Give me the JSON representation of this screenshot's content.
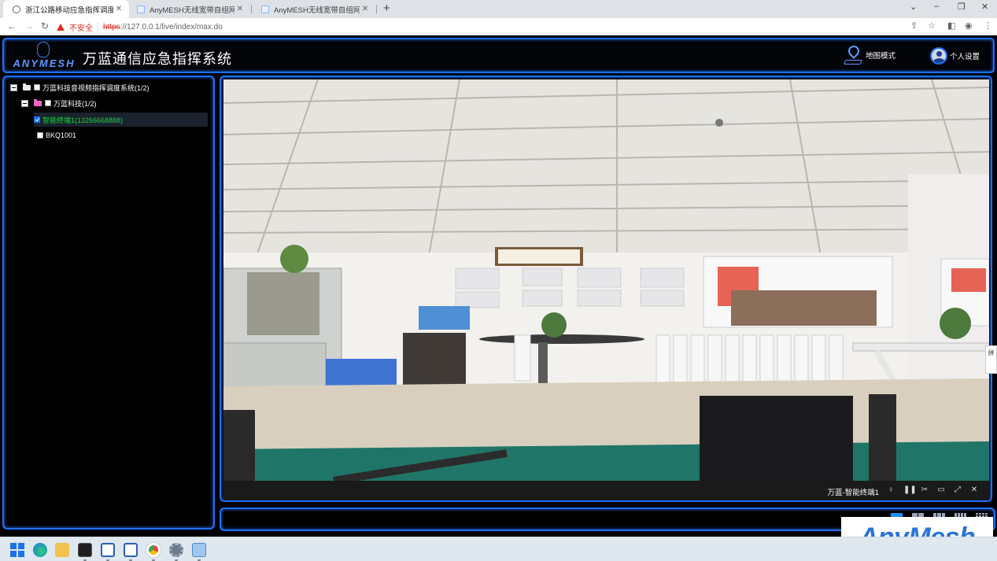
{
  "browser": {
    "tabs": [
      {
        "title": "浙江公路移动应急指挥调度系统",
        "active": true
      },
      {
        "title": "AnyMESH无线宽带自组网管理系",
        "active": false
      },
      {
        "title": "AnyMESH无线宽带自组网管理系",
        "active": false
      }
    ],
    "security_label": "不安全",
    "url_scheme": "https",
    "url_rest": "://127.0.0.1/live/index/max.do"
  },
  "header": {
    "logo_text": "ANYMESH",
    "title": "万蓝通信应急指挥系统",
    "map_mode_label": "地图模式",
    "settings_label": "个人设置"
  },
  "tree": {
    "root": {
      "label": "万蓝科技音视频指挥调度系统(1/2)"
    },
    "group": {
      "label": "万蓝科技(1/2)"
    },
    "devices": [
      {
        "label": "智能终端1(13266668888)",
        "checked": true,
        "selected": true
      },
      {
        "label": "BKQ1001",
        "checked": false,
        "selected": false
      }
    ]
  },
  "video": {
    "title": "万蓝-智能终端1",
    "controls": [
      "mic-icon",
      "pause-icon",
      "snapshot-icon",
      "record-icon",
      "fullscreen-icon",
      "close-icon"
    ]
  },
  "layouts": [
    "1",
    "4",
    "6",
    "8",
    "16"
  ],
  "side_handle": "拼",
  "watermark": "AnyMesh",
  "colors": {
    "accent": "#1e6fff",
    "selected_text": "#19d43a",
    "panel_bg": "#000000"
  }
}
